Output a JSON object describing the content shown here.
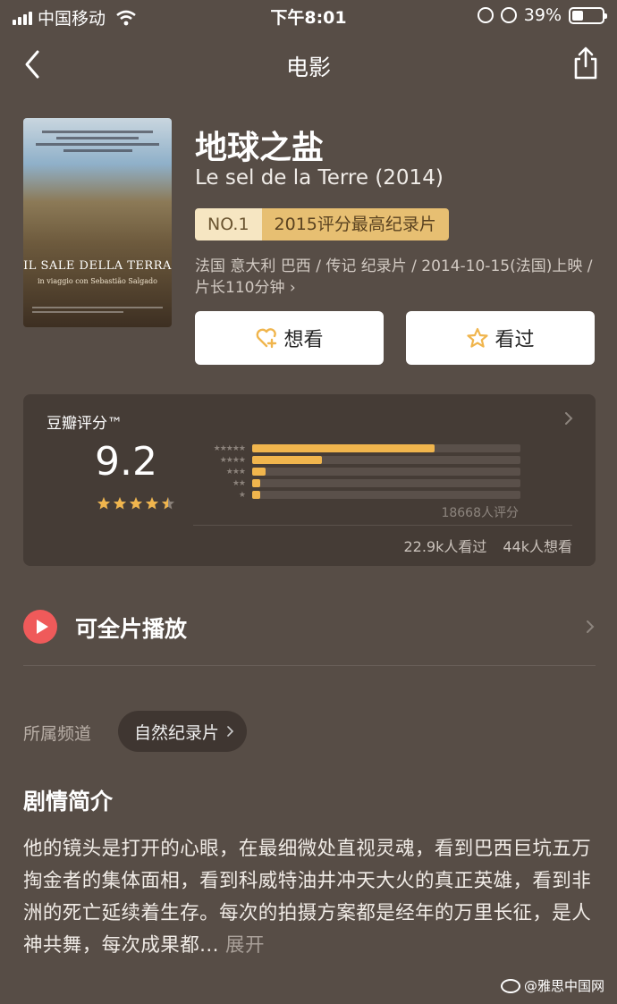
{
  "status_bar": {
    "carrier": "中国移动",
    "time": "下午8:01",
    "battery": "39%",
    "battery_level": 0.39
  },
  "nav": {
    "title": "电影"
  },
  "movie": {
    "title": "地球之盐",
    "original_title": "Le sel de la Terre (2014)",
    "rank_no": "NO.1",
    "rank_text": "2015评分最高纪录片",
    "meta": "法国 意大利 巴西 / 传记 纪录片 / 2014-10-15(法国)上映 / 片长110分钟",
    "meta_arrow": "›",
    "poster": {
      "title": "IL SALE DELLA TERRA",
      "subtitle": "in viaggio con Sebastião Salgado"
    }
  },
  "actions": {
    "want_label": "想看",
    "seen_label": "看过"
  },
  "rating": {
    "label": "豆瓣评分™",
    "score": "9.2",
    "stars": 4.5,
    "distribution": [
      {
        "stars": 5,
        "fraction": 0.68
      },
      {
        "stars": 4,
        "fraction": 0.26
      },
      {
        "stars": 3,
        "fraction": 0.05
      },
      {
        "stars": 2,
        "fraction": 0.03
      },
      {
        "stars": 1,
        "fraction": 0.03
      }
    ],
    "count": "18668人评分",
    "watched": "22.9k人看过",
    "want": "44k人想看"
  },
  "play": {
    "label": "可全片播放"
  },
  "channel": {
    "label": "所属频道",
    "value": "自然纪录片"
  },
  "summary": {
    "title": "剧情简介",
    "text": "他的镜头是打开的心眼，在最细微处直视灵魂，看到巴西巨坑五万掏金者的集体面相，看到科威特油井冲天大火的真正英雄，看到非洲的死亡延续着生存。每次的拍摄方案都是经年的万里长征，是人神共舞，每次成果都...",
    "more": "展开"
  },
  "watermark": "@雅思中国网",
  "colors": {
    "background": "#574d46",
    "card": "#453c36",
    "accent": "#f0b54d",
    "play": "#ef5a5a"
  }
}
